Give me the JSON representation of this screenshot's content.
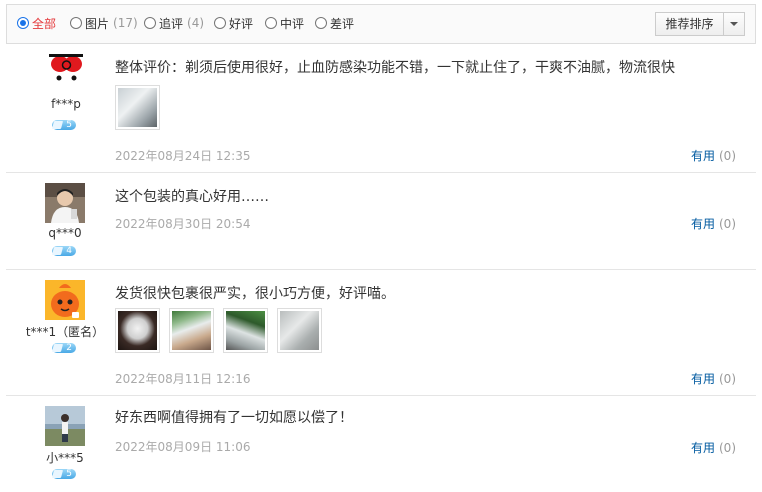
{
  "filters": [
    {
      "label": "全部",
      "count": "",
      "selected": true
    },
    {
      "label": "图片",
      "count": "(17)",
      "selected": false
    },
    {
      "label": "追评",
      "count": "(4)",
      "selected": false
    },
    {
      "label": "好评",
      "count": "",
      "selected": false
    },
    {
      "label": "中评",
      "count": "",
      "selected": false
    },
    {
      "label": "差评",
      "count": "",
      "selected": false
    }
  ],
  "sort": {
    "label": "推荐排序"
  },
  "reviews": [
    {
      "user": "f***p",
      "level": "5",
      "text": "整体评价：剃须后使用很好，止血防感染功能不错，一下就止住了，干爽不油腻，物流很快",
      "date": "2022年08月24日 12:35",
      "useful_label": "有用",
      "useful_count": "(0)"
    },
    {
      "user": "q***0",
      "level": "4",
      "text": "这个包装的真心好用……",
      "date": "2022年08月30日 20:54",
      "useful_label": "有用",
      "useful_count": "(0)"
    },
    {
      "user": "t***1（匿名）",
      "level": "2",
      "text": "发货很快包裹很严实，很小巧方便，好评喵。",
      "date": "2022年08月11日 12:16",
      "useful_label": "有用",
      "useful_count": "(0)"
    },
    {
      "user": "小***5",
      "level": "5",
      "text": "好东西啊值得拥有了一切如愿以偿了！",
      "date": "2022年08月09日 11:06",
      "useful_label": "有用",
      "useful_count": "(0)"
    }
  ]
}
